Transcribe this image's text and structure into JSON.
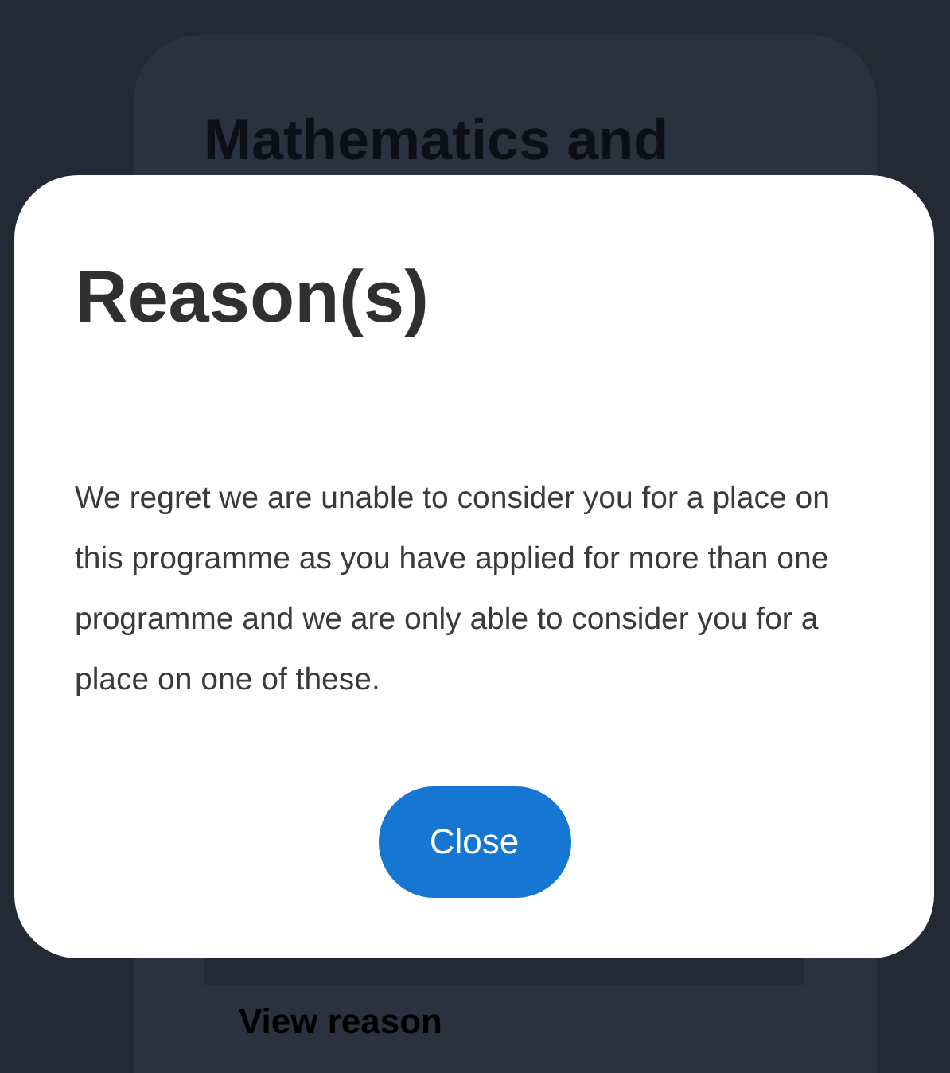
{
  "background_card": {
    "title": "Mathematics and",
    "link": "View reason"
  },
  "dialog": {
    "title": "Reason(s)",
    "message": "We regret we are unable to consider you for a place on this programme as you have applied for more than one programme and we are only able to consider you for a place on one of these.",
    "button": "Close"
  }
}
